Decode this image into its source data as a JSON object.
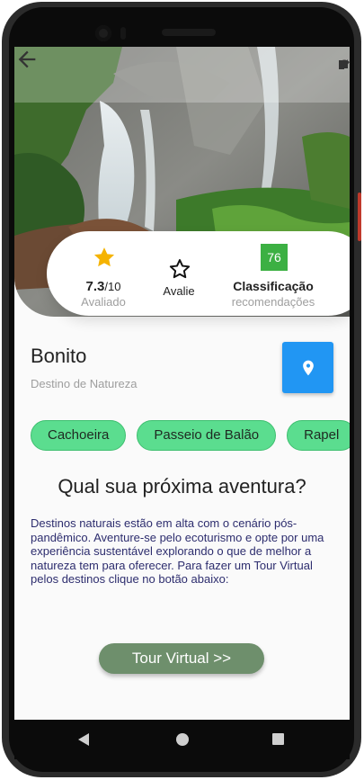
{
  "hero": {
    "image_desc": "waterfall-photo"
  },
  "status_icons": [
    "wifi-icon",
    "signal-icon",
    "battery-icon"
  ],
  "rating": {
    "score": "7.3",
    "score_max": "/10",
    "score_label": "Avaliado",
    "rate_label": "Avalie",
    "badge_value": "76",
    "classification_title": "Classificação",
    "classification_sub": "recomendações"
  },
  "destination": {
    "name": "Bonito",
    "type": "Destino de Natureza"
  },
  "chips": [
    "Cachoeira",
    "Passeio de Balão",
    "Rapel"
  ],
  "headline": "Qual sua próxima aventura?",
  "description": "Destinos naturais estão em alta com o cenário pós-pandêmico. Aventure-se pelo ecoturismo e opte por uma experiência sustentável explorando o que de melhor a natureza tem para oferecer. Para fazer um Tour Virtual pelos destinos clique no botão abaixo:",
  "tour_button": "Tour Virtual  >>",
  "colors": {
    "map_button": "#2196f3",
    "chip": "#5bdd8f",
    "badge": "#3cb043",
    "tour_button": "#6e8f6c",
    "star": "#f5b300"
  }
}
